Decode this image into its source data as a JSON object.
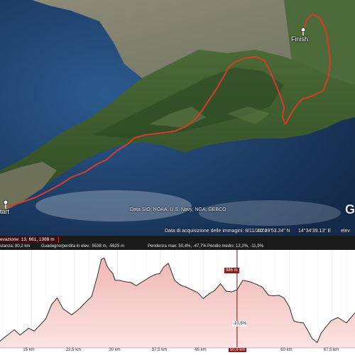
{
  "map": {
    "attribution": "Data SIO, NOAA, U.S. Navy, NGA, GEBCO",
    "acquisition": "Data di acquisizione delle immagini: 8/11/2014",
    "coord_lat": "40°39'53.24\" N",
    "coord_lon": "14°34'39.13\" E",
    "coord_elev_prefix": "elev",
    "google_logo": "G",
    "start_label": "tart",
    "finish_label": "Finish",
    "colors": {
      "track": "#d93a2b",
      "sea": "#1d3f6d",
      "land": "#3d5a2e"
    }
  },
  "stats": {
    "elevation_badge": "evazione: 13, 661, 1388 m",
    "distanza": "stanza: 80,2 km",
    "guadagno": "Guadagno/perdita in elev.: 5538 m, -5625 m",
    "pendenza_max": "Pendenza max: 50,4%, -47,7%",
    "pendio_medio": "Pendio medio: 12,2%, -11,9%"
  },
  "profile": {
    "x_ticks": [
      "15 km",
      "22,5 km",
      "30 km",
      "37,5 km",
      "45 km",
      "50,9 km",
      "60 km",
      "67,5 km"
    ],
    "current_marker": {
      "elevation": "986 m",
      "grade": "-10,5%",
      "distance": "50,9 km"
    },
    "colors": {
      "fill": "#f4c9c6",
      "line": "#1a1a1a",
      "cursor": "#7a1010"
    }
  },
  "chart_data": {
    "type": "area",
    "xlabel": "",
    "ylabel": "",
    "x_ticks": [
      "15 km",
      "22,5 km",
      "30 km",
      "37,5 km",
      "45 km",
      "50,9 km",
      "60 km",
      "67,5 km"
    ],
    "ylim": [
      13,
      1388
    ],
    "xlim": [
      9.5,
      71.5
    ],
    "series": [
      {
        "x": [
          9.5,
          10.5,
          12,
          13,
          14.5,
          15.5,
          16.5,
          17.5,
          18.5,
          19.5,
          20.5,
          21.5,
          22,
          22.5,
          23.5,
          24.5,
          25.5,
          26.5,
          27.2,
          27.7,
          28.2,
          28.7,
          29.2,
          29.6,
          30.3,
          31.3,
          32.3,
          33.3,
          34,
          34.8,
          35.7,
          36.7,
          37.4,
          38.1,
          38.9,
          40,
          41,
          42,
          43,
          44,
          45,
          46,
          47,
          48,
          49,
          50,
          50.9,
          51.9,
          53.1,
          54.3,
          55.3,
          56.4,
          57.3,
          58.2,
          59.1,
          60,
          60.8,
          61.5,
          62.5,
          63.3,
          64,
          64.9,
          65.6,
          66.4,
          67.3,
          68.5,
          70,
          71.5
        ],
        "y": [
          100,
          170,
          270,
          190,
          290,
          250,
          340,
          430,
          640,
          740,
          580,
          520,
          490,
          520,
          590,
          680,
          760,
          1060,
          1310,
          1330,
          1210,
          1150,
          1100,
          1000,
          1000,
          980,
          970,
          920,
          960,
          1000,
          1050,
          1090,
          1100,
          1200,
          1250,
          1000,
          930,
          900,
          860,
          820,
          730,
          800,
          850,
          950,
          840,
          830,
          860,
          1000,
          980,
          940,
          900,
          780,
          770,
          780,
          740,
          610,
          400,
          380,
          370,
          250,
          140,
          80,
          220,
          310,
          400,
          450,
          370,
          520
        ]
      }
    ]
  }
}
